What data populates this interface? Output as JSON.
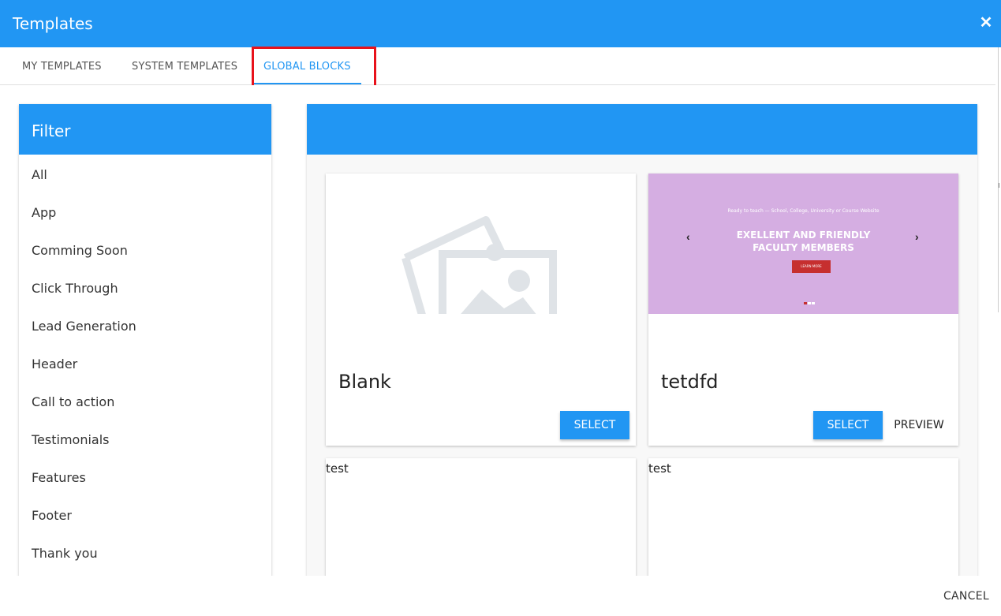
{
  "dialog": {
    "title": "Templates",
    "close_icon": "close-icon"
  },
  "tabs": [
    {
      "label": "MY TEMPLATES",
      "active": false
    },
    {
      "label": "SYSTEM TEMPLATES",
      "active": false
    },
    {
      "label": "GLOBAL BLOCKS",
      "active": true
    }
  ],
  "filter": {
    "title": "Filter",
    "items": [
      "All",
      "App",
      "Comming Soon",
      "Click Through",
      "Lead Generation",
      "Header",
      "Call to action",
      "Testimonials",
      "Features",
      "Footer",
      "Thank you"
    ]
  },
  "cards": [
    {
      "title": "Blank",
      "media": "placeholder-image-icon",
      "select_label": "SELECT"
    },
    {
      "title": "tetdfd",
      "select_label": "SELECT",
      "preview_label": "PREVIEW",
      "slide": {
        "small_text": "Ready to teach — School, College, University or Course Website",
        "heading_line1": "EXELLENT AND FRIENDLY",
        "heading_line2": "FACULTY MEMBERS",
        "button_text": "LEARN MORE",
        "prev_icon": "chevron-left-icon",
        "next_icon": "chevron-right-icon",
        "background": "#d5aee2"
      }
    },
    {
      "text": "test"
    },
    {
      "text": "test"
    }
  ],
  "footer": {
    "cancel_label": "CANCEL"
  },
  "colors": {
    "accent": "#2196f3",
    "highlight": "#e8121b"
  }
}
